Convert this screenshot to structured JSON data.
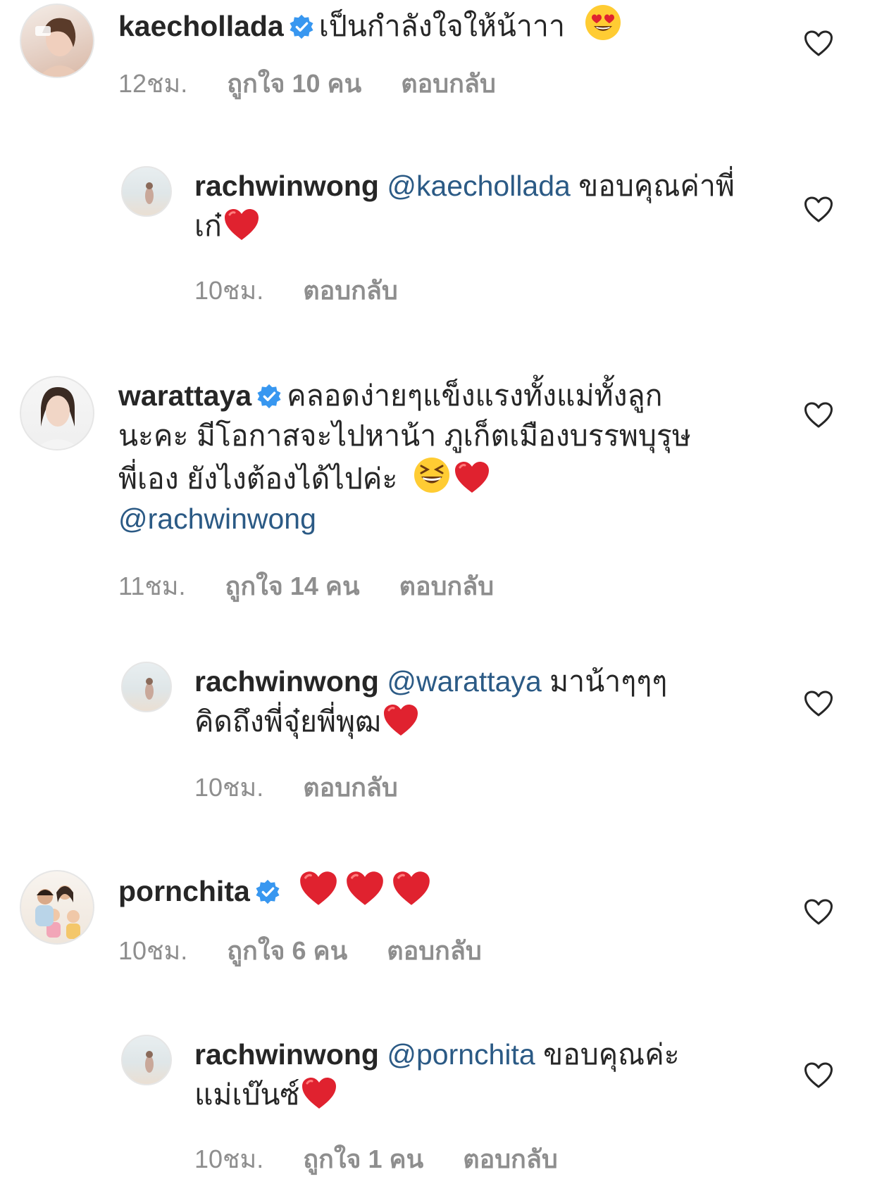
{
  "comments": [
    {
      "username": "kaechollada",
      "verified": true,
      "text": "เป็นกำลังใจให้น้าาา",
      "emoji": "heart-eyes",
      "time": "12ชม.",
      "likes": "ถูกใจ 10 คน",
      "reply": "ตอบกลับ"
    },
    {
      "username": "rachwinwong",
      "mention": "@kaechollada",
      "text": "ขอบคุณค่าพี่เก๋",
      "emoji": "red-heart",
      "time": "10ชม.",
      "reply": "ตอบกลับ"
    },
    {
      "username": "warattaya",
      "verified": true,
      "text_line1": "คลอดง่ายๆแข็งแรงทั้งแม่ทั้งลูก",
      "text_line2": "นะคะ มีโอกาสจะไปหาน้า ภูเก็ตเมืองบรรพบุรุษ",
      "text_line3": "พี่เอง ยังไงต้องได้ไปค่ะ",
      "mention": "@rachwinwong",
      "emoji": "grinning-squint + red-heart",
      "time": "11ชม.",
      "likes": "ถูกใจ 14 คน",
      "reply": "ตอบกลับ"
    },
    {
      "username": "rachwinwong",
      "mention": "@warattaya",
      "text_line1": "มาน้าๆๆๆ",
      "text_line2": "คิดถึงพี่จุ๋ยพี่พุฒ",
      "emoji": "red-heart",
      "time": "10ชม.",
      "reply": "ตอบกลับ"
    },
    {
      "username": "pornchita",
      "verified": true,
      "emoji": "red-heart x3",
      "time": "10ชม.",
      "likes": "ถูกใจ 6 คน",
      "reply": "ตอบกลับ"
    },
    {
      "username": "rachwinwong",
      "mention": "@pornchita",
      "text_line1": "ขอบคุณค่ะ",
      "text_line2": "แม่เบ๊นซ์",
      "emoji": "red-heart",
      "time": "10ชม.",
      "likes": "ถูกใจ 1 คน",
      "reply": "ตอบกลับ"
    }
  ],
  "icons": {
    "like": "heart-outline-icon",
    "verified": "verified-badge-icon"
  },
  "colors": {
    "text": "#262626",
    "meta": "#8e8e8e",
    "mention": "#2b5a85",
    "verified": "#3897f0",
    "heart": "#e0222f"
  }
}
